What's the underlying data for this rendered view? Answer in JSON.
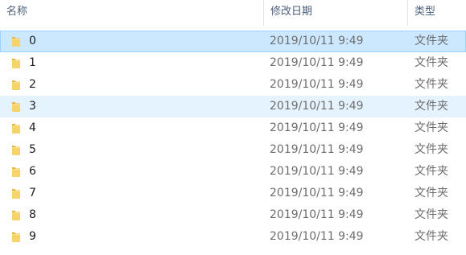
{
  "header": {
    "name_label": "名称",
    "date_label": "修改日期",
    "type_label": "类型",
    "sort_glyph": "^"
  },
  "rows": [
    {
      "name": "0",
      "date": "2019/10/11 9:49",
      "type": "文件夹",
      "state": "selected"
    },
    {
      "name": "1",
      "date": "2019/10/11 9:49",
      "type": "文件夹",
      "state": "normal"
    },
    {
      "name": "2",
      "date": "2019/10/11 9:49",
      "type": "文件夹",
      "state": "normal"
    },
    {
      "name": "3",
      "date": "2019/10/11 9:49",
      "type": "文件夹",
      "state": "hover"
    },
    {
      "name": "4",
      "date": "2019/10/11 9:49",
      "type": "文件夹",
      "state": "normal"
    },
    {
      "name": "5",
      "date": "2019/10/11 9:49",
      "type": "文件夹",
      "state": "normal"
    },
    {
      "name": "6",
      "date": "2019/10/11 9:49",
      "type": "文件夹",
      "state": "normal"
    },
    {
      "name": "7",
      "date": "2019/10/11 9:49",
      "type": "文件夹",
      "state": "normal"
    },
    {
      "name": "8",
      "date": "2019/10/11 9:49",
      "type": "文件夹",
      "state": "normal"
    },
    {
      "name": "9",
      "date": "2019/10/11 9:49",
      "type": "文件夹",
      "state": "normal"
    }
  ],
  "icons": {
    "row_icon": "folder-icon"
  },
  "colors": {
    "selected_bg": "#cce8ff",
    "selected_border": "#99d1ff",
    "hover_bg": "#e5f3ff",
    "header_text": "#4c607a",
    "folder_yellow": "#f5c84a"
  }
}
